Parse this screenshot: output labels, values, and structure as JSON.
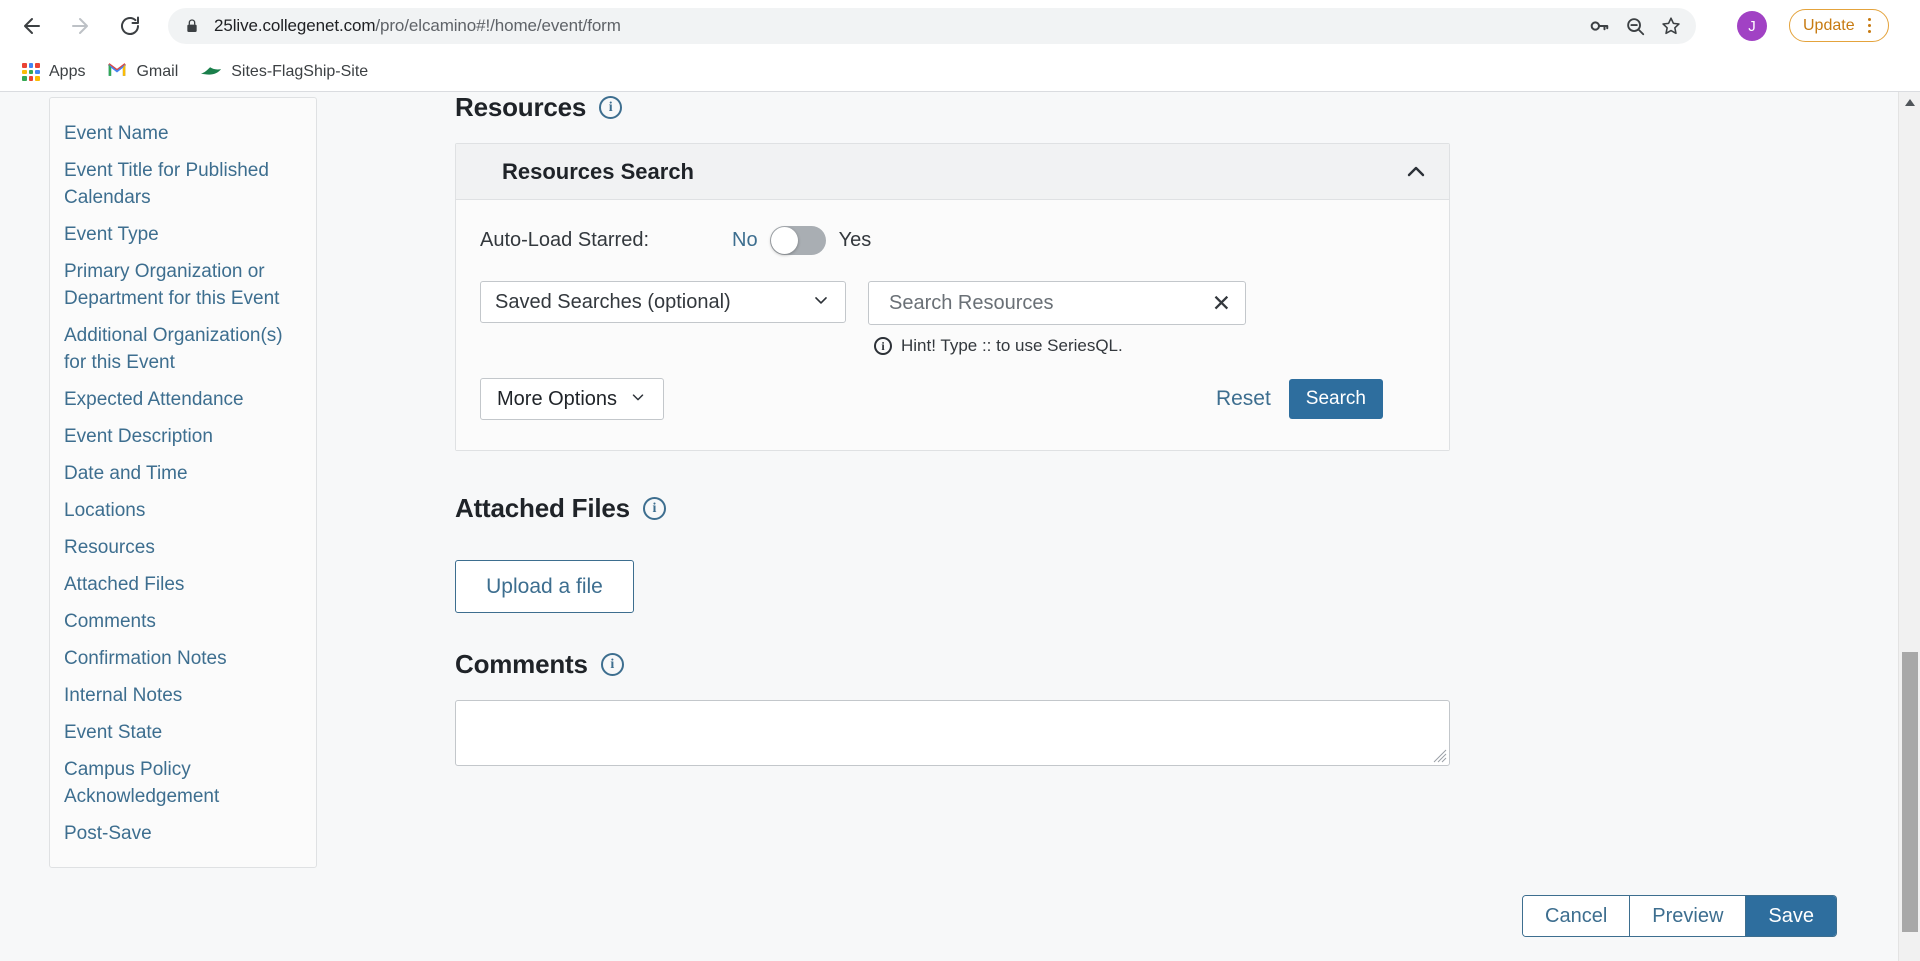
{
  "browser": {
    "back_icon": "arrow-back-icon",
    "forward_icon": "arrow-forward-icon",
    "reload_icon": "reload-icon",
    "lock_icon": "lock-icon",
    "url_host": "25live.collegenet.com",
    "url_path": "/pro/elcamino#!/home/event/form",
    "omnibox_icons": [
      "key-icon",
      "zoom-out-icon",
      "bookmark-star-icon"
    ],
    "avatar_initial": "J",
    "update_label": "Update",
    "menu_icon": "three-dot-menu-icon",
    "bookmarks": [
      {
        "label": "Apps",
        "icon": "apps-grid-icon"
      },
      {
        "label": "Gmail",
        "icon": "gmail-icon"
      },
      {
        "label": "Sites-FlagShip-Site",
        "icon": "sites-icon"
      }
    ]
  },
  "sidebar": {
    "items": [
      {
        "label": "Event Name"
      },
      {
        "label": "Event Title for Published Calendars"
      },
      {
        "label": "Event Type"
      },
      {
        "label": "Primary Organization or Department for this Event"
      },
      {
        "label": "Additional Organization(s) for this Event"
      },
      {
        "label": "Expected Attendance"
      },
      {
        "label": "Event Description"
      },
      {
        "label": "Date and Time"
      },
      {
        "label": "Locations"
      },
      {
        "label": "Resources"
      },
      {
        "label": "Attached Files"
      },
      {
        "label": "Comments"
      },
      {
        "label": "Confirmation Notes"
      },
      {
        "label": "Internal Notes"
      },
      {
        "label": "Event State"
      },
      {
        "label": "Campus Policy Acknowledgement"
      },
      {
        "label": "Post-Save"
      }
    ]
  },
  "resources": {
    "title": "Resources",
    "info_icon": "info-icon",
    "panel": {
      "header_title": "Resources Search",
      "collapse_icon": "chevron-up-icon",
      "autoload": {
        "label": "Auto-Load Starred:",
        "off_label": "No",
        "on_label": "Yes",
        "state": "No"
      },
      "saved_searches": {
        "selected": "Saved Searches (optional)",
        "chevron_icon": "chevron-down-icon"
      },
      "search_input": {
        "placeholder": "Search Resources",
        "value": "",
        "clear_icon": "close-x-icon"
      },
      "hint": {
        "icon": "info-icon",
        "text": "Hint! Type :: to use SeriesQL."
      },
      "more_options_label": "More Options",
      "more_options_icon": "chevron-down-icon",
      "reset_label": "Reset",
      "search_label": "Search"
    }
  },
  "attached_files": {
    "title": "Attached Files",
    "info_icon": "info-icon",
    "upload_label": "Upload a file"
  },
  "comments": {
    "title": "Comments",
    "info_icon": "info-icon",
    "value": "",
    "resize_icon": "resize-handle-icon"
  },
  "footer": {
    "cancel_label": "Cancel",
    "preview_label": "Preview",
    "save_label": "Save"
  },
  "colors": {
    "accent_blue": "#2e6e9e",
    "link_blue": "#3d6e8f",
    "update_orange": "#c77b12",
    "avatar_purple": "#a142c4"
  }
}
